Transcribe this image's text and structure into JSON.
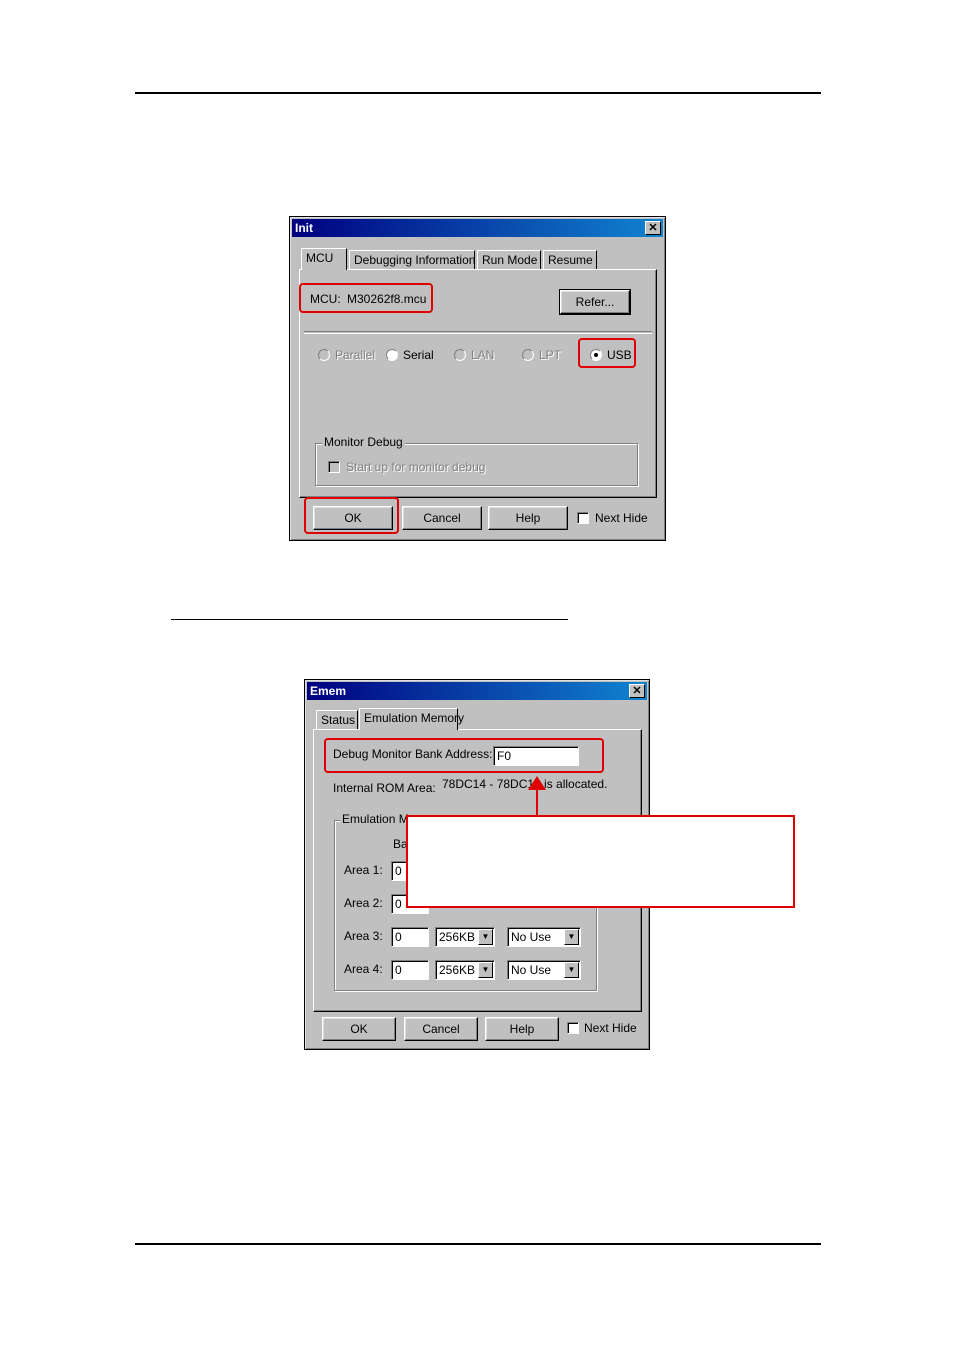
{
  "init_dialog": {
    "title": "Init",
    "tabs": [
      "MCU",
      "Debugging Information",
      "Run Mode",
      "Resume"
    ],
    "mcu_label": "MCU:",
    "mcu_value": "M30262f8.mcu",
    "refer_button": "Refer...",
    "connections": [
      "Parallel",
      "Serial",
      "LAN",
      "LPT",
      "USB"
    ],
    "selected_connection": "USB",
    "monitor_debug_group": "Monitor Debug",
    "monitor_debug_checkbox": "Start up for monitor debug",
    "buttons": {
      "ok": "OK",
      "cancel": "Cancel",
      "help": "Help"
    },
    "next_hide": "Next Hide"
  },
  "emem_dialog": {
    "title": "Emem",
    "tabs": [
      "Status",
      "Emulation Memory"
    ],
    "debug_monitor_label": "Debug Monitor Bank Address:",
    "debug_monitor_value": "F0",
    "internal_rom_label": "Internal ROM Area:",
    "internal_rom_value": "78DC14 - 78DC14 is allocated.",
    "group_label": "Emulation Me",
    "column_label_partial": "Ba",
    "areas": [
      {
        "label": "Area 1:",
        "bank": "0",
        "size": "",
        "use": ""
      },
      {
        "label": "Area 2:",
        "bank": "0",
        "size": "",
        "use": ""
      },
      {
        "label": "Area 3:",
        "bank": "0",
        "size": "256KB",
        "use": "No Use"
      },
      {
        "label": "Area 4:",
        "bank": "0",
        "size": "256KB",
        "use": "No Use"
      }
    ],
    "buttons": {
      "ok": "OK",
      "cancel": "Cancel",
      "help": "Help"
    },
    "next_hide": "Next Hide"
  },
  "colors": {
    "highlight": "#e00000",
    "titlebar": "#000080",
    "dialog_bg": "#c0c0c0"
  }
}
